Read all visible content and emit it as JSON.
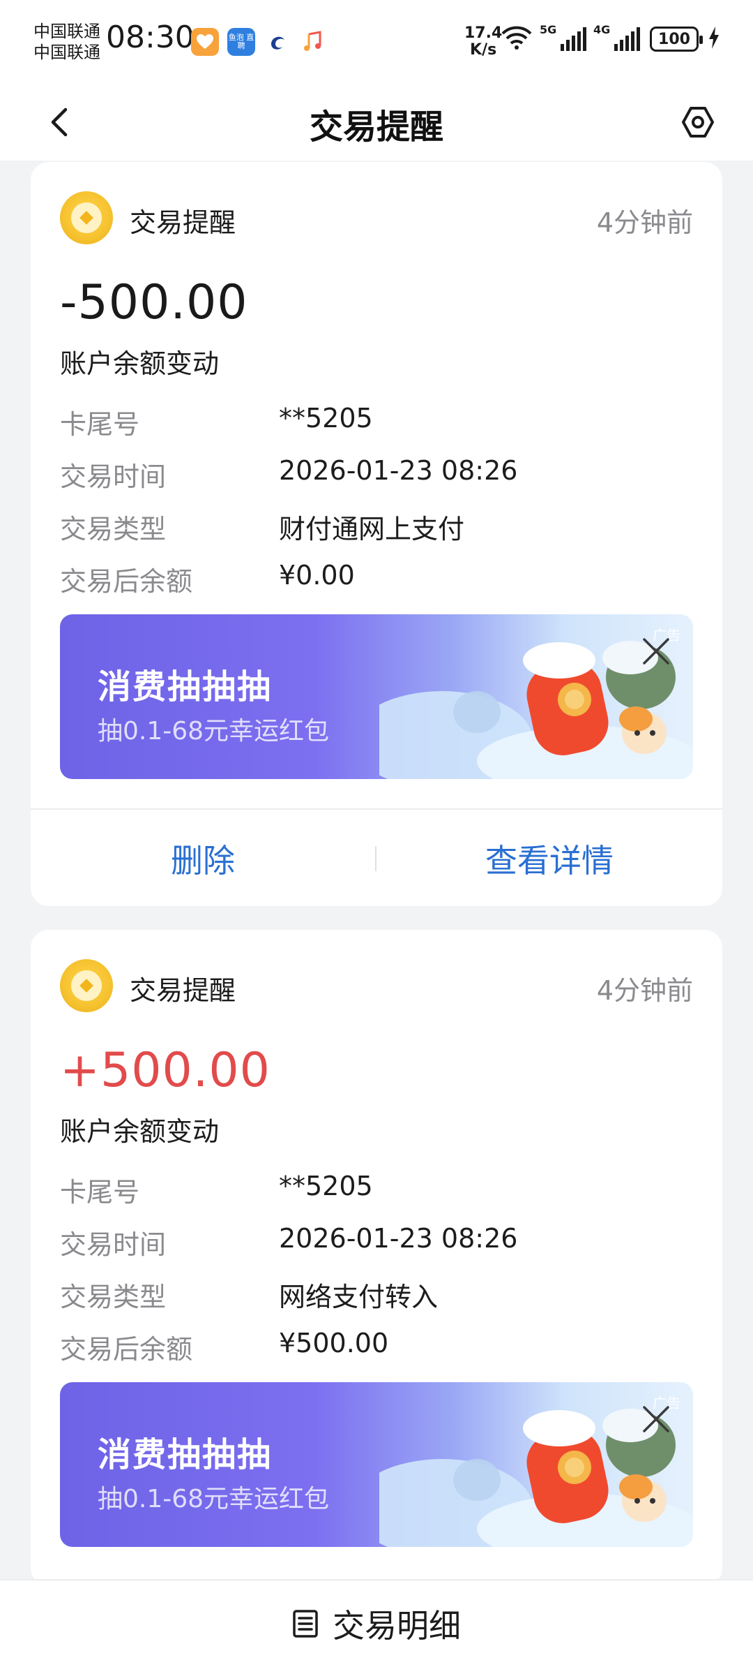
{
  "status_bar": {
    "carrier_1": "中国联通",
    "carrier_2": "中国联通",
    "time": "08:30",
    "net_speed_value": "17.4",
    "net_speed_unit": "K/s",
    "signal_1_label": "5G",
    "signal_2_label": "4G",
    "battery": "100",
    "app_icon_label": "鱼泡 直聘"
  },
  "header": {
    "title": "交易提醒"
  },
  "notifications": [
    {
      "source": "交易提醒",
      "time_ago": "4分钟前",
      "amount": "-500.00",
      "change_label": "账户余额变动",
      "details": [
        {
          "key": "卡尾号",
          "value": "**5205"
        },
        {
          "key": "交易时间",
          "value": "2026-01-23 08:26"
        },
        {
          "key": "交易类型",
          "value": "财付通网上支付"
        },
        {
          "key": "交易后余额",
          "value": "¥0.00"
        }
      ],
      "ad": {
        "title": "消费抽抽抽",
        "subtitle": "抽0.1-68元幸运红包",
        "tag": "广告"
      },
      "actions": {
        "delete": "删除",
        "view_details": "查看详情"
      }
    },
    {
      "source": "交易提醒",
      "time_ago": "4分钟前",
      "amount": "+500.00",
      "change_label": "账户余额变动",
      "details": [
        {
          "key": "卡尾号",
          "value": "**5205"
        },
        {
          "key": "交易时间",
          "value": "2026-01-23 08:26"
        },
        {
          "key": "交易类型",
          "value": "网络支付转入"
        },
        {
          "key": "交易后余额",
          "value": "¥500.00"
        }
      ],
      "ad": {
        "title": "消费抽抽抽",
        "subtitle": "抽0.1-68元幸运红包",
        "tag": "广告"
      }
    }
  ],
  "bottom_bar": {
    "label": "交易明细",
    "icon": "list-icon"
  },
  "colors": {
    "negative_amount": "#1a1a1a",
    "positive_amount": "#e24b4b",
    "action_blue": "#2a6fd1",
    "coin_gold": "#f6c22f",
    "ad_purple": "#6e63e6"
  }
}
